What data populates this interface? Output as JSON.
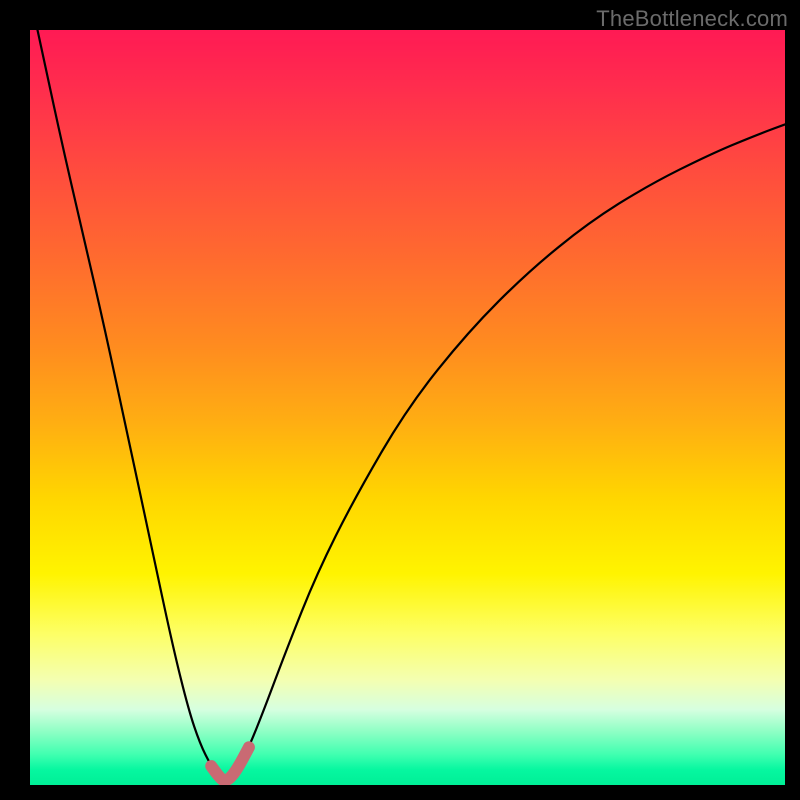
{
  "watermark": {
    "text": "TheBottleneck.com"
  },
  "colors": {
    "frame": "#000000",
    "curve": "#000000",
    "highlight_stroke": "#c96a73",
    "highlight_fill": "none"
  },
  "chart_data": {
    "type": "line",
    "title": "",
    "xlabel": "",
    "ylabel": "",
    "xlim": [
      0,
      1
    ],
    "ylim": [
      0,
      100
    ],
    "grid": false,
    "series": [
      {
        "name": "curve",
        "x": [
          0.01,
          0.04,
          0.07,
          0.1,
          0.13,
          0.16,
          0.19,
          0.21,
          0.225,
          0.24,
          0.252,
          0.258,
          0.265,
          0.275,
          0.29,
          0.31,
          0.34,
          0.38,
          0.43,
          0.5,
          0.58,
          0.66,
          0.74,
          0.82,
          0.9,
          0.96,
          1.0
        ],
        "values": [
          100.0,
          86.0,
          73.0,
          60.0,
          46.0,
          32.0,
          18.0,
          10.0,
          5.5,
          2.5,
          0.9,
          0.5,
          0.9,
          2.2,
          5.0,
          10.0,
          18.0,
          28.0,
          38.0,
          50.0,
          60.0,
          68.0,
          74.5,
          79.5,
          83.5,
          86.0,
          87.5
        ]
      }
    ],
    "highlight": {
      "name": "near-minimum-band",
      "x_range": [
        0.235,
        0.29
      ],
      "y_range": [
        0.5,
        4.0
      ]
    },
    "gradient_stops_pct": {
      "0": "#ff1a54",
      "50": "#ffc400",
      "80": "#fdff66",
      "100": "#00ef96"
    }
  }
}
